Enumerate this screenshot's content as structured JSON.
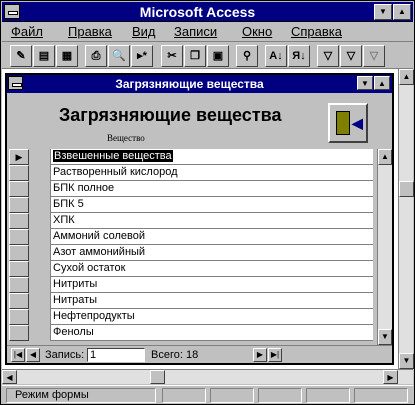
{
  "app": {
    "title": "Microsoft Access"
  },
  "menu": [
    {
      "label": "Файл"
    },
    {
      "label": "Правка"
    },
    {
      "label": "Вид"
    },
    {
      "label": "Записи"
    },
    {
      "label": "Окно"
    },
    {
      "label": "Справка"
    }
  ],
  "toolbar": {
    "buttons": [
      {
        "icon": "design-view-icon",
        "glyph": "✎"
      },
      {
        "icon": "form-view-icon",
        "glyph": "▤"
      },
      {
        "icon": "datasheet-view-icon",
        "glyph": "▦"
      },
      {
        "icon": "print-icon",
        "glyph": "⎙"
      },
      {
        "icon": "print-preview-icon",
        "glyph": "🔍"
      },
      {
        "icon": "new-record-icon",
        "glyph": "▸*"
      },
      {
        "icon": "cut-icon",
        "glyph": "✂"
      },
      {
        "icon": "copy-icon",
        "glyph": "❐"
      },
      {
        "icon": "paste-icon",
        "glyph": "📋"
      },
      {
        "icon": "find-icon",
        "glyph": "⚲"
      },
      {
        "icon": "sort-ascending-icon",
        "glyph": "A↓"
      },
      {
        "icon": "sort-descending-icon",
        "glyph": "Я↓"
      },
      {
        "icon": "filter-by-selection-icon",
        "glyph": "▽"
      },
      {
        "icon": "filter-by-form-icon",
        "glyph": "▽≡"
      },
      {
        "icon": "apply-filter-icon",
        "glyph": "▽"
      }
    ]
  },
  "form": {
    "window_title": "Загрязняющие вещества",
    "heading": "Загрязняющие вещества",
    "field_caption": "Вещество",
    "exit_button": {
      "icon": "exit-door-icon"
    },
    "records": [
      "Взвешенные вещества",
      "Растворенный кислород",
      "БПК полное",
      "БПК 5",
      "ХПК",
      "Аммоний солевой",
      "Азот аммонийный",
      "Сухой остаток",
      "Нитриты",
      "Нитраты",
      "Нефтепродукты",
      "Фенолы"
    ],
    "current_record_index": 0,
    "nav": {
      "record_label": "Запись:",
      "record_value": "1",
      "total_label": "Всего: 18"
    }
  },
  "status": {
    "text": "Режим формы"
  },
  "colors": {
    "titlebar": "#000080",
    "chrome": "#c0c0c0",
    "selection": "#000000"
  }
}
